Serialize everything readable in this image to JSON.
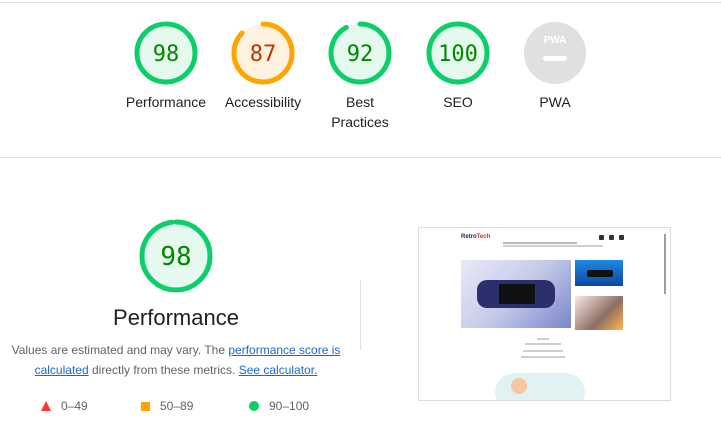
{
  "colors": {
    "pass": "#0cce6b",
    "pass_text": "#008800",
    "pass_bg": "#e6f9ee",
    "average": "#ffa400",
    "average_text": "#c33300",
    "average_bg": "#fff3e0",
    "fail": "#ff3333",
    "na": "#e0e0e0"
  },
  "summary": {
    "gauges": [
      {
        "name": "performance",
        "score": 98,
        "label": "Performance",
        "level": "pass"
      },
      {
        "name": "accessibility",
        "score": 87,
        "label": "Accessibility",
        "level": "average"
      },
      {
        "name": "best-practices",
        "score": 92,
        "label": "Best\nPractices",
        "level": "pass"
      },
      {
        "name": "seo",
        "score": 100,
        "label": "SEO",
        "level": "pass"
      },
      {
        "name": "pwa",
        "score": null,
        "label": "PWA",
        "level": "na",
        "badge": "PWA"
      }
    ]
  },
  "performance": {
    "score": 98,
    "title": "Performance",
    "desc_prefix": "Values are estimated and may vary. The ",
    "link_score": "performance score is calculated",
    "desc_middle": " directly from these metrics. ",
    "link_calc": "See calculator.",
    "legend": [
      {
        "shape": "triangle",
        "range": "0–49"
      },
      {
        "shape": "square",
        "range": "50–89"
      },
      {
        "shape": "circle",
        "range": "90–100"
      }
    ]
  },
  "screenshot": {
    "logo_a": "Retro",
    "logo_b": "Tech",
    "icon": "page-screenshot-thumbnail"
  }
}
